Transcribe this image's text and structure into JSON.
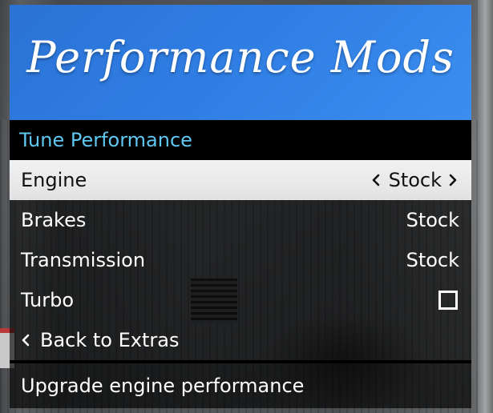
{
  "menu": {
    "banner_title": "Performance Mods",
    "subtitle": "Tune Performance",
    "items": [
      {
        "label": "Engine",
        "value": "Stock",
        "selected": true
      },
      {
        "label": "Brakes",
        "value": "Stock"
      },
      {
        "label": "Transmission",
        "value": "Stock"
      },
      {
        "label": "Turbo",
        "checked": false
      }
    ],
    "back_label": "Back to Extras",
    "description": "Upgrade engine performance"
  },
  "colors": {
    "banner_blue": "#2f7de3",
    "subtitle_cyan": "#5fc8f2",
    "selected_bg": "#e9e9e9"
  },
  "icons": {
    "selector_left": "chevron-left-icon",
    "selector_right": "chevron-right-icon",
    "back": "chevron-left-icon",
    "turbo_toggle": "checkbox-icon"
  }
}
